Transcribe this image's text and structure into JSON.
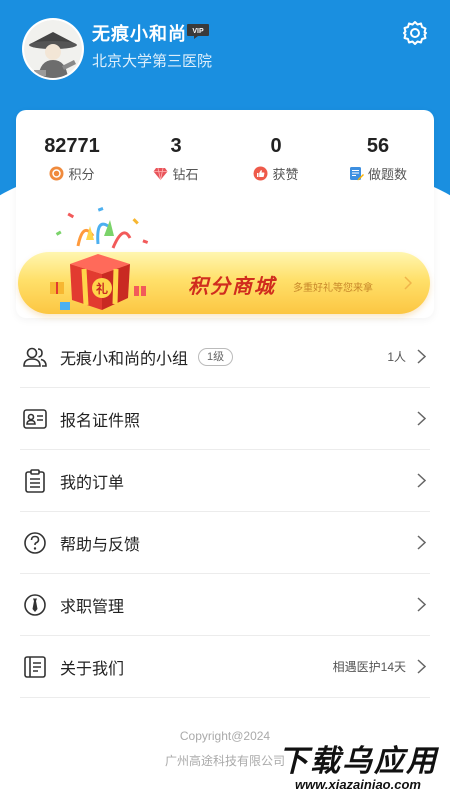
{
  "profile": {
    "username": "无痕小和尚",
    "vip_label": "VIP",
    "hospital": "北京大学第三医院"
  },
  "stats": [
    {
      "value": "82771",
      "label": "积分",
      "icon": "points-icon",
      "color": "#f08a3c"
    },
    {
      "value": "3",
      "label": "钻石",
      "icon": "diamond-icon",
      "color": "#e8545a"
    },
    {
      "value": "0",
      "label": "获赞",
      "icon": "thumbs-up-icon",
      "color": "#ee5a4a"
    },
    {
      "value": "56",
      "label": "做题数",
      "icon": "quiz-icon",
      "color": "#3d8fe0"
    }
  ],
  "banner": {
    "title": "积分商城",
    "subtitle": "多重好礼等您来拿",
    "gift_label": "礼"
  },
  "menu": [
    {
      "label": "无痕小和尚的小组",
      "tag": "1级",
      "right": "1人",
      "icon": "group-icon"
    },
    {
      "label": "报名证件照",
      "tag": "",
      "right": "",
      "icon": "id-card-icon"
    },
    {
      "label": "我的订单",
      "tag": "",
      "right": "",
      "icon": "order-clipboard-icon"
    },
    {
      "label": "帮助与反馈",
      "tag": "",
      "right": "",
      "icon": "help-question-icon"
    },
    {
      "label": "求职管理",
      "tag": "",
      "right": "",
      "icon": "job-tie-icon"
    },
    {
      "label": "关于我们",
      "tag": "",
      "right": "相遇医护14天",
      "icon": "about-book-icon"
    }
  ],
  "footer": {
    "copyright": "Copyright@2024",
    "company": "广州高途科技有限公司"
  },
  "watermark": {
    "main": "下载乌应用",
    "url": "www.xiazainiao.com"
  },
  "colors": {
    "header_blue": "#1a8fe0",
    "banner_red": "#d02c1e"
  }
}
